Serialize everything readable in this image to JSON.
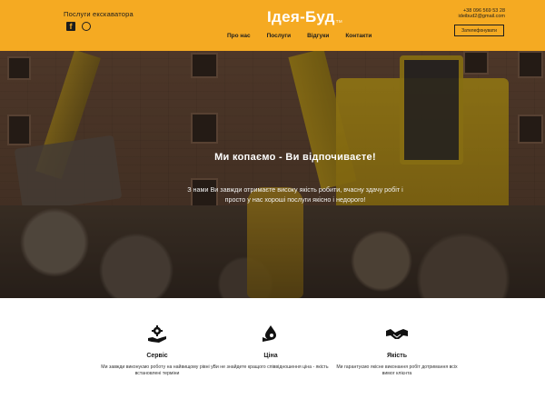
{
  "header": {
    "services_label": "Послуги екскаватора",
    "logo": "Ідея-Буд",
    "logo_mark": "TM",
    "nav": [
      "Про нас",
      "Послуги",
      "Відгуки",
      "Контакти"
    ],
    "phone": "+38 096 569 53 28",
    "email": "ideibud2@gmail.com",
    "call_button": "Зателефонувати",
    "social_icons": [
      "facebook-icon",
      "viber-icon"
    ]
  },
  "hero": {
    "title": "Ми копаємо - Ви відпочиваєте!",
    "text": "З нами Ви завжди отримаєте високу якість робити, вчасну здачу робіт і просто у нас хороші послуги якісно і недорого!"
  },
  "features": [
    {
      "icon": "gear-hand-icon",
      "title": "Сервіс",
      "text": "Ми завжди виконуємо роботу на найвищому рівні у встановлені терміни"
    },
    {
      "icon": "hand-drop-icon",
      "title": "Ціна",
      "text": "Ви не знайдете кращого співвідношення ціна - якість"
    },
    {
      "icon": "handshake-icon",
      "title": "Якість",
      "text": "Ми гарантуємо якісне виконання робіт дотримання всіх вимог клієнта"
    }
  ],
  "colors": {
    "accent": "#f5aa22",
    "text_dark": "#1d1d1d"
  }
}
